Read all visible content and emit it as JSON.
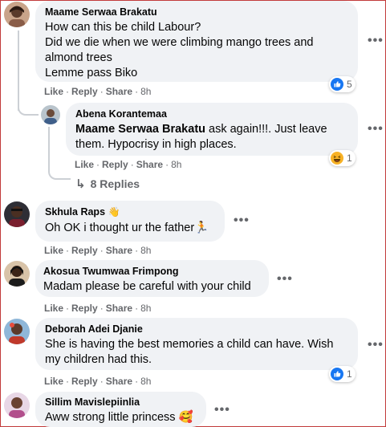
{
  "comments": [
    {
      "author": "Maame Serwaa Brakatu",
      "text": "How can this be child Labour?\nDid we die when we were climbing mango trees and almond trees\nLemme pass Biko",
      "actions": {
        "like": "Like",
        "reply": "Reply",
        "share": "Share",
        "time": "8h"
      },
      "reactions": {
        "icon": "like-icon",
        "count": "5"
      },
      "reply": {
        "author": "Abena Korantemaa",
        "mention": "Maame Serwaa Brakatu",
        "text": " ask again!!!. Just leave them. Hypocrisy in high places.",
        "actions": {
          "like": "Like",
          "reply": "Reply",
          "share": "Share",
          "time": "8h"
        },
        "reactions": {
          "icon": "haha-icon",
          "count": "1"
        }
      },
      "view_replies": "8 Replies"
    },
    {
      "author": "Skhula Raps",
      "author_badge": "👋",
      "text": "Oh OK i thought ur the father🏃",
      "actions": {
        "like": "Like",
        "reply": "Reply",
        "share": "Share",
        "time": "8h"
      }
    },
    {
      "author": "Akosua Twumwaa Frimpong",
      "text": "Madam please be careful with your child",
      "actions": {
        "like": "Like",
        "reply": "Reply",
        "share": "Share",
        "time": "8h"
      }
    },
    {
      "author": "Deborah Adei Djanie",
      "text": "She is having the best memories a child can have. Wish my children had this.",
      "actions": {
        "like": "Like",
        "reply": "Reply",
        "share": "Share",
        "time": "8h"
      },
      "reactions": {
        "icon": "like-icon",
        "count": "1"
      }
    },
    {
      "author": "Sillim Mavislepiinlia",
      "text": "Aww strong little princess 🥰"
    }
  ],
  "more_options_label": "•••",
  "dot_separator": "·",
  "colors": {
    "bubble": "#f0f2f5",
    "meta": "#65676b",
    "like_blue": "#1877f2",
    "frame": "#c23b3b"
  }
}
